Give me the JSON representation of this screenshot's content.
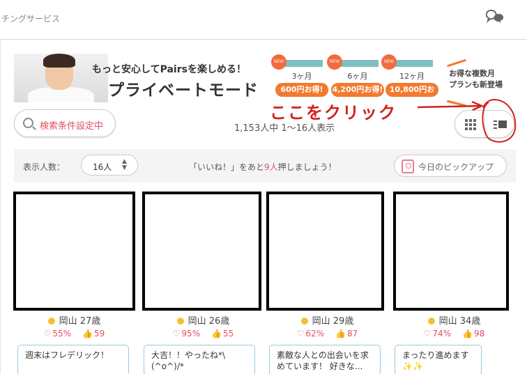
{
  "header": {
    "brand_partial": "チングサービス",
    "chat_icon": "chat-bubbles-icon"
  },
  "banner": {
    "tagline": "もっと安心してPairsを楽しめる！",
    "title": "プライベートモード",
    "plans": [
      {
        "badge": "NEW",
        "months": "3ヶ月",
        "deal": "600円お得!"
      },
      {
        "badge": "NEW",
        "months": "6ヶ月",
        "deal": "4,200円お得!"
      },
      {
        "badge": "NEW",
        "months": "12ヶ月",
        "deal": "10,800円お得!"
      }
    ],
    "promo_line1": "お得な複数月",
    "promo_line2": "プランも新登場"
  },
  "search": {
    "filter_label": "検索条件設定中"
  },
  "annotation": {
    "text": "ここをクリック",
    "color": "#d42020"
  },
  "results": {
    "count_text": "1,153人中 1〜16人表示"
  },
  "toolbar": {
    "per_page_label": "表示人数：",
    "per_page_value": "16人",
    "msg_prefix": "「いいね！」をあと",
    "msg_count": "9人",
    "msg_suffix": "押しましょう！",
    "pickup_label": "今日のピックアップ"
  },
  "cards": [
    {
      "meta": "岡山 27歳",
      "match": "55%",
      "likes": "59",
      "bubble": "週末はフレデリック！"
    },
    {
      "meta": "岡山 26歳",
      "match": "95%",
      "likes": "55",
      "bubble": "大吉！！やったね*\\(^o^)/*"
    },
    {
      "meta": "岡山 29歳",
      "match": "62%",
      "likes": "87",
      "bubble": "素敵な人との出会いを求めています！ 好きな..."
    },
    {
      "meta": "岡山 34歳",
      "match": "74%",
      "likes": "98",
      "bubble": "まったり進めます✨✨"
    }
  ],
  "colors": {
    "accent_pink": "#e05063",
    "online_dot": "#f1c232",
    "deal_orange": "#f27a2f",
    "plan_teal": "#7fbfc1"
  }
}
